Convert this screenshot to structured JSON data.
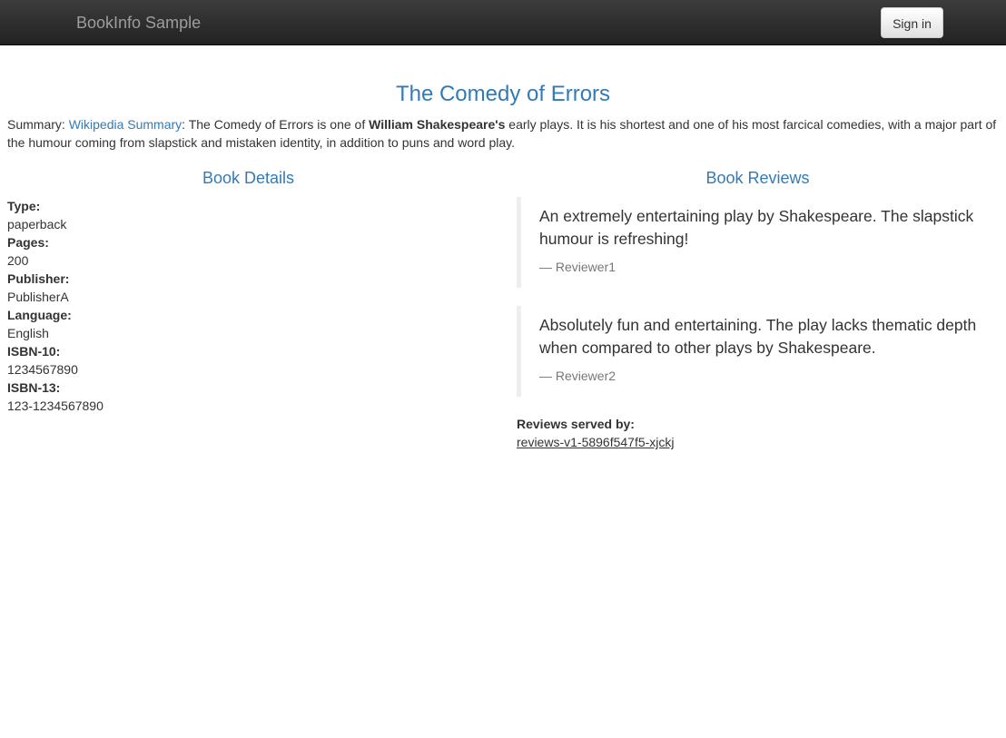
{
  "navbar": {
    "brand": "BookInfo Sample",
    "signin_label": "Sign in"
  },
  "book": {
    "title": "The Comedy of Errors",
    "summary_prefix": "Summary: ",
    "summary_link": "Wikipedia Summary",
    "summary_text_1": ": The Comedy of Errors is one of ",
    "summary_bold": "William Shakespeare's",
    "summary_text_2": " early plays. It is his shortest and one of his most farcical comedies, with a major part of the humour coming from slapstick and mistaken identity, in addition to puns and word play."
  },
  "details": {
    "heading": "Book Details",
    "items": [
      {
        "label": "Type:",
        "value": "paperback"
      },
      {
        "label": "Pages:",
        "value": "200"
      },
      {
        "label": "Publisher:",
        "value": "PublisherA"
      },
      {
        "label": "Language:",
        "value": "English"
      },
      {
        "label": "ISBN-10:",
        "value": "1234567890"
      },
      {
        "label": "ISBN-13:",
        "value": "123-1234567890"
      }
    ]
  },
  "reviews": {
    "heading": "Book Reviews",
    "items": [
      {
        "text": "An extremely entertaining play by Shakespeare. The slapstick humour is refreshing!",
        "author": "— Reviewer1"
      },
      {
        "text": "Absolutely fun and entertaining. The play lacks thematic depth when compared to other plays by Shakespeare.",
        "author": "— Reviewer2"
      }
    ],
    "served_by_label": "Reviews served by:",
    "served_by_pod": "reviews-v1-5896f547f5-xjckj"
  }
}
